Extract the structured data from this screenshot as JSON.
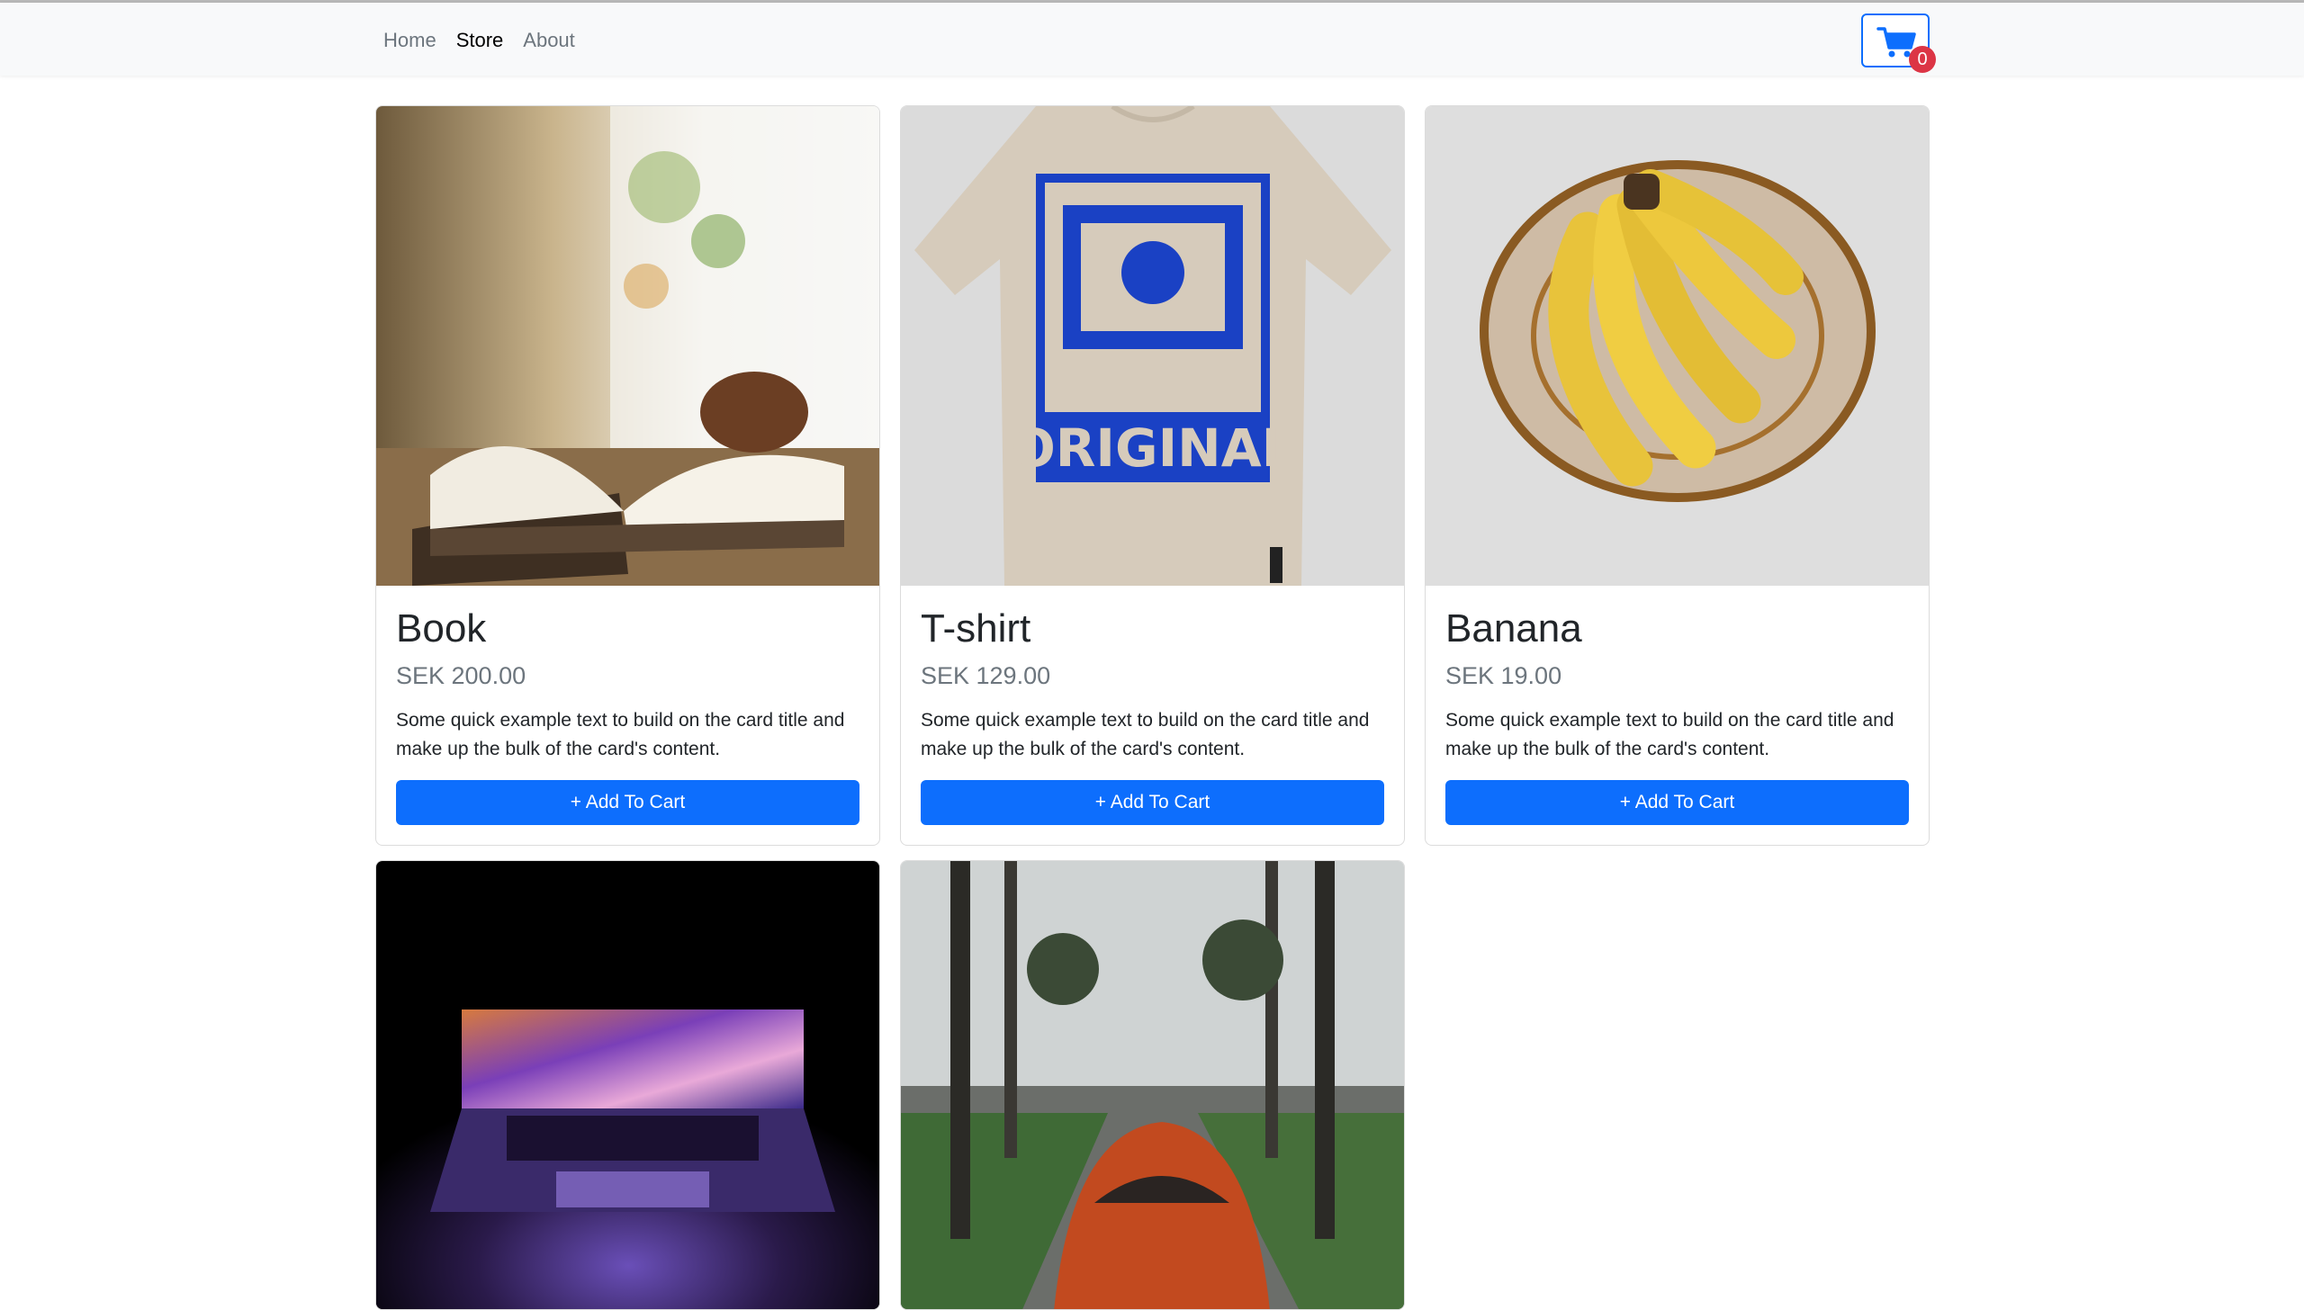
{
  "nav": {
    "links": [
      {
        "label": "Home",
        "active": false
      },
      {
        "label": "Store",
        "active": true
      },
      {
        "label": "About",
        "active": false
      }
    ],
    "cart_icon": "cart-icon",
    "cart_count": "0"
  },
  "products": [
    {
      "name": "Book",
      "price": "SEK 200.00",
      "description": "Some quick example text to build on the card title and make up the bulk of the card's content.",
      "button": "+ Add To Cart",
      "image": "book-photo"
    },
    {
      "name": "T-shirt",
      "price": "SEK 129.00",
      "description": "Some quick example text to build on the card title and make up the bulk of the card's content.",
      "button": "+ Add To Cart",
      "image": "tshirt-photo",
      "shirt_print": "ORIGINAL"
    },
    {
      "name": "Banana",
      "price": "SEK 19.00",
      "description": "Some quick example text to build on the card title and make up the bulk of the card's content.",
      "button": "+ Add To Cart",
      "image": "banana-photo"
    },
    {
      "image": "laptop-photo"
    },
    {
      "image": "car-photo"
    }
  ],
  "colors": {
    "primary": "#0d6efd",
    "badge": "#dc3545",
    "navbar_bg": "#f8f9fa",
    "muted": "#6c757d"
  }
}
